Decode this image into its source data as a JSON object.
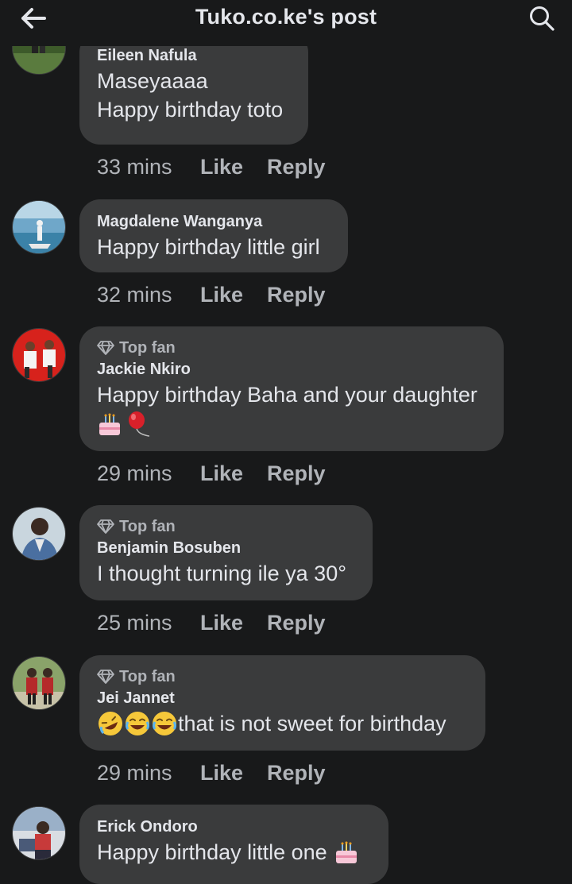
{
  "header": {
    "title": "Tuko.co.ke's post",
    "back_icon": "arrow-left-icon",
    "search_icon": "search-icon"
  },
  "actions": {
    "like_label": "Like",
    "reply_label": "Reply"
  },
  "comments": [
    {
      "author": "Eileen Nafula",
      "text": "Maseyaaaa\nHappy birthday toto",
      "time": "33 mins"
    },
    {
      "author": "Magdalene Wanganya",
      "text": "Happy birthday little girl",
      "time": "32 mins"
    },
    {
      "badge": "Top fan",
      "author": "Jackie Nkiro",
      "text": "Happy birthday Baha and your daughter",
      "emojis": [
        "birthday-cake-emoji",
        "balloon-emoji"
      ],
      "time": "29 mins"
    },
    {
      "badge": "Top fan",
      "author": "Benjamin Bosuben",
      "text": "I thought turning ile ya 30°",
      "time": "25 mins"
    },
    {
      "badge": "Top fan",
      "author": "Jei Jannet",
      "emojis": [
        "rolling-laughing-emoji",
        "tears-of-joy-emoji",
        "tears-of-joy-emoji"
      ],
      "text": "that is not sweet for birthday",
      "time": "29 mins"
    },
    {
      "author": "Erick Ondoro",
      "text": "Happy birthday little one",
      "emojis": [
        "birthday-cake-emoji"
      ]
    }
  ],
  "colors": {
    "background": "#18191a",
    "bubble": "#3a3b3c",
    "primary_text": "#e4e6eb",
    "secondary_text": "#b0b3b8"
  }
}
